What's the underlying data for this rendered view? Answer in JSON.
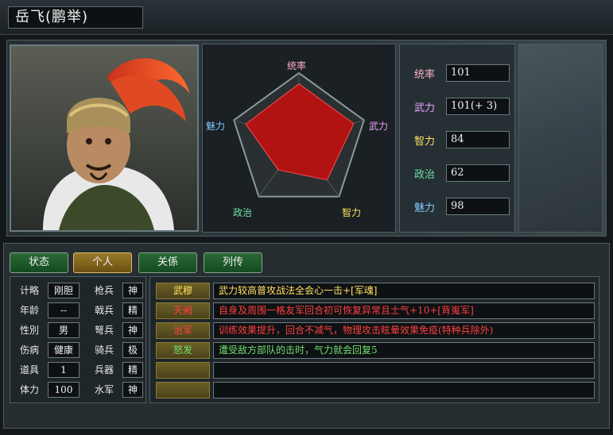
{
  "header": {
    "name": "岳飞(鹏举)"
  },
  "radar": {
    "labels": {
      "top": "统率",
      "right": "武力",
      "bottom_right": "智力",
      "bottom_left": "政治",
      "left": "魅力"
    },
    "values": {
      "leadership": 101,
      "war": 101,
      "intelligence": 84,
      "politics": 62,
      "charm": 98
    },
    "max": 120
  },
  "stats": [
    {
      "label": "统率",
      "value": "101",
      "color": "#ffb0c8"
    },
    {
      "label": "武力",
      "value": "101(+ 3)",
      "color": "#e8a0ff"
    },
    {
      "label": "智力",
      "value": "84",
      "color": "#ffe060"
    },
    {
      "label": "政治",
      "value": "62",
      "color": "#70e0a0"
    },
    {
      "label": "魅力",
      "value": "98",
      "color": "#80c8ff"
    }
  ],
  "tabs": [
    {
      "label": "状态",
      "active": false
    },
    {
      "label": "个人",
      "active": true
    },
    {
      "label": "关係",
      "active": false
    },
    {
      "label": "列传",
      "active": false
    }
  ],
  "attributes_left": [
    {
      "label": "计略",
      "value": "刚胆"
    },
    {
      "label": "年龄",
      "value": "--"
    },
    {
      "label": "性別",
      "value": "男"
    },
    {
      "label": "伤病",
      "value": "健康"
    },
    {
      "label": "道具",
      "value": "1"
    },
    {
      "label": "体力",
      "value": "100"
    }
  ],
  "attributes_right": [
    {
      "label": "枪兵",
      "value": "神"
    },
    {
      "label": "戟兵",
      "value": "精"
    },
    {
      "label": "弩兵",
      "value": "神"
    },
    {
      "label": "骑兵",
      "value": "极"
    },
    {
      "label": "兵器",
      "value": "精"
    },
    {
      "label": "水军",
      "value": "神"
    }
  ],
  "skills": [
    {
      "name": "武穆",
      "name_color": "#ffe060",
      "desc": "武力较高普攻战法全会心一击+[军魂]",
      "desc_color": "#ffe060"
    },
    {
      "name": "天阙",
      "name_color": "#ff4040",
      "desc": "自身及周围一格友军回合初可恢复异常且士气+10+[背嵬军]",
      "desc_color": "#ff4040"
    },
    {
      "name": "治军",
      "name_color": "#ff4040",
      "desc": "训练效果提升，回合不减气，物理攻击眩晕效果免疫(特种兵除外)",
      "desc_color": "#ff4040"
    },
    {
      "name": "怒发",
      "name_color": "#70e070",
      "desc": "遭受敌方部队的击时，气力就会回复5",
      "desc_color": "#70e070"
    },
    {
      "name": "",
      "name_color": "#e0e0e0",
      "desc": "",
      "desc_color": "#e0e0e0"
    },
    {
      "name": "",
      "name_color": "#e0e0e0",
      "desc": "",
      "desc_color": "#e0e0e0"
    }
  ]
}
